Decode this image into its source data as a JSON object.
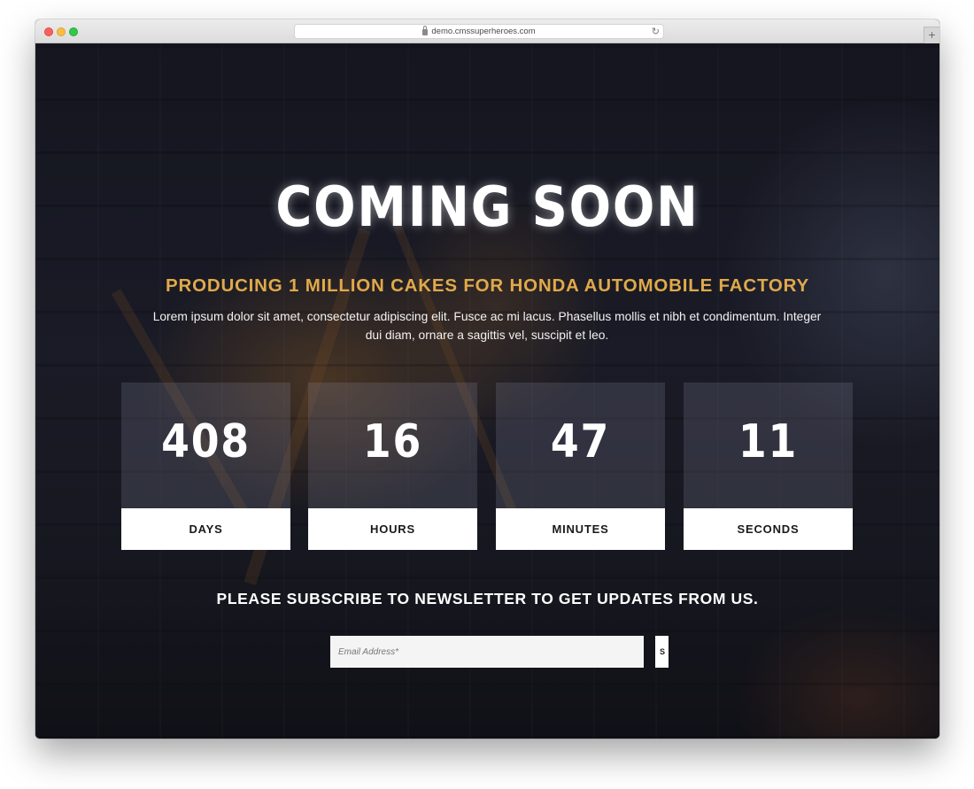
{
  "browser": {
    "url": "demo.cmssuperheroes.com",
    "new_tab_label": "+",
    "reload_glyph": "↻"
  },
  "hero": {
    "title": "COMING SOON",
    "subtitle": "PRODUCING 1 MILLION CAKES FOR HONDA AUTOMOBILE FACTORY",
    "description": "Lorem ipsum dolor sit amet, consectetur adipiscing elit. Fusce ac mi lacus. Phasellus mollis et nibh et condimentum. Integer dui diam, ornare a sagittis vel, suscipit et leo."
  },
  "countdown": [
    {
      "value": "408",
      "label": "DAYS"
    },
    {
      "value": "16",
      "label": "HOURS"
    },
    {
      "value": "47",
      "label": "MINUTES"
    },
    {
      "value": "11",
      "label": "SECONDS"
    }
  ],
  "newsletter": {
    "heading": "PLEASE SUBSCRIBE TO NEWSLETTER TO GET UPDATES FROM US.",
    "email_placeholder": "Email Address*",
    "submit_label": "S"
  },
  "colors": {
    "accent": "#e0a94a",
    "text": "#ffffff",
    "label_bg": "#ffffff"
  }
}
